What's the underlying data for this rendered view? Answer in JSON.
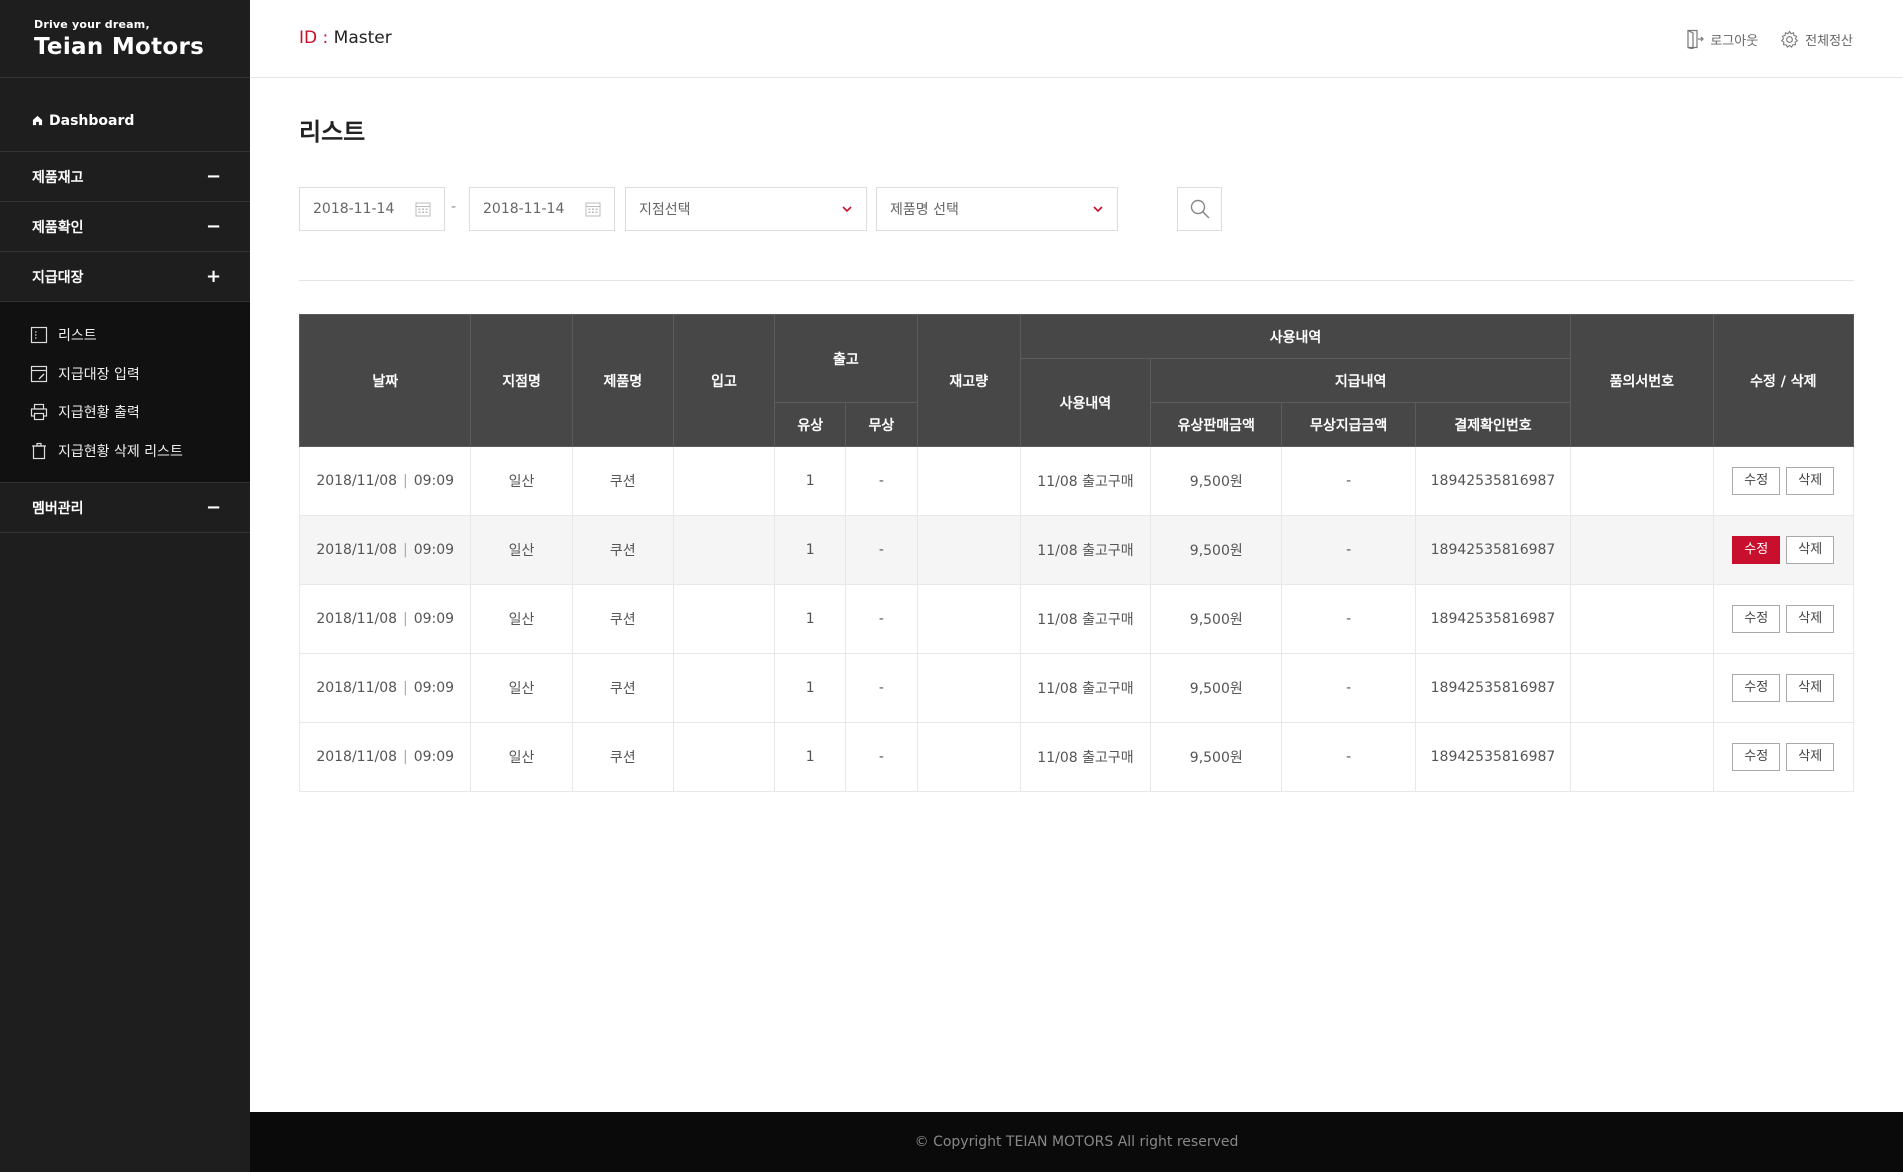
{
  "logo": {
    "tagline": "Drive your dream,",
    "brand": "Teian Motors"
  },
  "sidebar": {
    "dashboard": "Dashboard",
    "menus": [
      {
        "label": "제품재고",
        "toggle": "−"
      },
      {
        "label": "제품확인",
        "toggle": "−"
      },
      {
        "label": "지급대장",
        "toggle": "+"
      }
    ],
    "submenu": [
      {
        "label": "리스트",
        "icon": "list-icon"
      },
      {
        "label": "지급대장 입력",
        "icon": "edit-form-icon"
      },
      {
        "label": "지급현황 출력",
        "icon": "printer-icon"
      },
      {
        "label": "지급현황 삭제 리스트",
        "icon": "trash-icon"
      }
    ],
    "member": {
      "label": "멤버관리",
      "toggle": "−"
    }
  },
  "header": {
    "id_label": "ID :",
    "id_value": "Master",
    "logout": "로그아웃",
    "settle_all": "전체정산"
  },
  "page": {
    "title": "리스트"
  },
  "filters": {
    "date_from": "2018-11-14",
    "date_sep": "-",
    "date_to": "2018-11-14",
    "branch_select": "지점선택",
    "product_select": "제품명 선택"
  },
  "table": {
    "headers": {
      "date": "날짜",
      "branch": "지점명",
      "product": "제품명",
      "incoming": "입고",
      "outgoing": "출고",
      "paid": "유상",
      "free": "무상",
      "stock": "재고량",
      "usage_group": "사용내역",
      "usage": "사용내역",
      "payment_group": "지급내역",
      "paid_amount": "유상판매금액",
      "free_amount": "무상지급금액",
      "payment_no": "결제확인번호",
      "approval_no": "품의서번호",
      "edit_delete": "수정 / 삭제"
    },
    "rows": [
      {
        "date": "2018/11/08",
        "time": "09:09",
        "branch": "일산",
        "product": "쿠션",
        "incoming": "",
        "paid": "1",
        "free": "-",
        "stock": "",
        "usage": "11/08 출고구매",
        "paid_amount": "9,500원",
        "free_amount": "-",
        "payment_no": "18942535816987",
        "approval_no": "",
        "edit": "수정",
        "delete": "삭제"
      },
      {
        "date": "2018/11/08",
        "time": "09:09",
        "branch": "일산",
        "product": "쿠션",
        "incoming": "",
        "paid": "1",
        "free": "-",
        "stock": "",
        "usage": "11/08 출고구매",
        "paid_amount": "9,500원",
        "free_amount": "-",
        "payment_no": "18942535816987",
        "approval_no": "",
        "edit": "수정",
        "delete": "삭제"
      },
      {
        "date": "2018/11/08",
        "time": "09:09",
        "branch": "일산",
        "product": "쿠션",
        "incoming": "",
        "paid": "1",
        "free": "-",
        "stock": "",
        "usage": "11/08 출고구매",
        "paid_amount": "9,500원",
        "free_amount": "-",
        "payment_no": "18942535816987",
        "approval_no": "",
        "edit": "수정",
        "delete": "삭제"
      },
      {
        "date": "2018/11/08",
        "time": "09:09",
        "branch": "일산",
        "product": "쿠션",
        "incoming": "",
        "paid": "1",
        "free": "-",
        "stock": "",
        "usage": "11/08 출고구매",
        "paid_amount": "9,500원",
        "free_amount": "-",
        "payment_no": "18942535816987",
        "approval_no": "",
        "edit": "수정",
        "delete": "삭제"
      },
      {
        "date": "2018/11/08",
        "time": "09:09",
        "branch": "일산",
        "product": "쿠션",
        "incoming": "",
        "paid": "1",
        "free": "-",
        "stock": "",
        "usage": "11/08 출고구매",
        "paid_amount": "9,500원",
        "free_amount": "-",
        "payment_no": "18942535816987",
        "approval_no": "",
        "edit": "수정",
        "delete": "삭제"
      }
    ]
  },
  "footer": {
    "copyright": "© Copyright TEIAN MOTORS All right reserved"
  },
  "colors": {
    "accent": "#c8102e",
    "sidebar_bg": "#1e1e1e",
    "table_header_bg": "#474747"
  }
}
